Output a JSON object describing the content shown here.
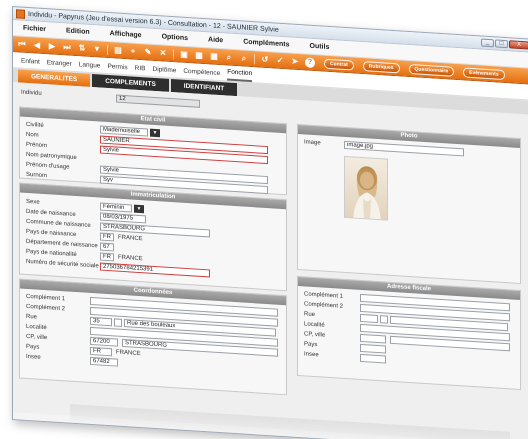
{
  "window": {
    "title": "Individu - Papyrus (Jeu d'essai version 6.3) - Consultation - 12 - SAUNIER Sylvie",
    "minimize": "_",
    "maximize": "□",
    "close": "X"
  },
  "menu": [
    "Fichier",
    "Edition",
    "Affichage",
    "Options",
    "Aide",
    "Compléments",
    "Outils"
  ],
  "toolbar": {
    "icons": [
      "⏮",
      "◀",
      "▶",
      "⏭",
      "⇅",
      "▼",
      "▤",
      "+",
      "✎",
      "✕",
      "▣",
      "▦",
      "▦",
      "⌕",
      "⌕",
      "↺",
      "✓",
      "➤"
    ],
    "pills": [
      "Contrat",
      "Rubriques",
      "Questionnaire",
      "Evènements"
    ],
    "help": "?"
  },
  "subtabs": [
    "Enfant",
    "Etranger",
    "Langue",
    "Permis",
    "RIB",
    "Diplôme",
    "Compétence",
    "Fonction"
  ],
  "maintabs": [
    "GENERALITES",
    "COMPLEMENTS",
    "IDENTIFIANT"
  ],
  "individu": {
    "label": "Individu",
    "value": "12"
  },
  "etat_civil": {
    "title": "Etat civil",
    "civilite_label": "Civilité",
    "civilite_value": "Mademoiselle",
    "nom_label": "Nom",
    "nom_value": "SAUNIER",
    "prenom_label": "Prénom",
    "prenom_value": "Sylvie",
    "nom_patro_label": "Nom patronymique",
    "prenom_usage_label": "Prénom d'usage",
    "prenom_usage_value": "Sylvie",
    "surnom_label": "Surnom",
    "surnom_value": "Syv"
  },
  "photo": {
    "title": "Photo",
    "image_label": "Image",
    "image_value": "image.jpg"
  },
  "immatriculation": {
    "title": "Immatriculation",
    "sexe_label": "Sexe",
    "sexe_value": "Féminin",
    "date_label": "Date de naissance",
    "date_value": "08/03/1975",
    "commune_label": "Commune de naissance",
    "commune_value": "STRASBOURG",
    "pays_naiss_label": "Pays de naissance",
    "pays_naiss_code": "FR",
    "pays_naiss_name": "FRANCE",
    "dept_label": "Département de naissance",
    "dept_value": "67",
    "pays_nat_label": "Pays de nationalité",
    "pays_nat_code": "FR",
    "pays_nat_name": "FRANCE",
    "secu_label": "Numéro de sécurité sociale",
    "secu_value": "275036784215391"
  },
  "coordonnees": {
    "title": "Coordonnées",
    "comp1_label": "Complément 1",
    "comp2_label": "Complément 2",
    "rue_label": "Rue",
    "rue_num": "35",
    "rue_value": "Rue des bouleaux",
    "localite_label": "Localité",
    "cp_label": "CP, ville",
    "cp_value": "67200",
    "ville_value": "STRASBOURG",
    "pays_label": "Pays",
    "pays_code": "FR",
    "pays_name": "FRANCE",
    "insee_label": "Insee",
    "insee_value": "67482"
  },
  "adresse_fiscale": {
    "title": "Adresse fiscale",
    "comp1_label": "Complément 1",
    "comp2_label": "Complément 2",
    "rue_label": "Rue",
    "localite_label": "Localité",
    "cp_label": "CP, ville",
    "pays_label": "Pays",
    "insee_label": "Insee"
  },
  "colors": {
    "accent": "#e56f10",
    "header": "#8a8a8a",
    "dark_tab": "#2e2e2e",
    "error_border": "#d04040"
  }
}
